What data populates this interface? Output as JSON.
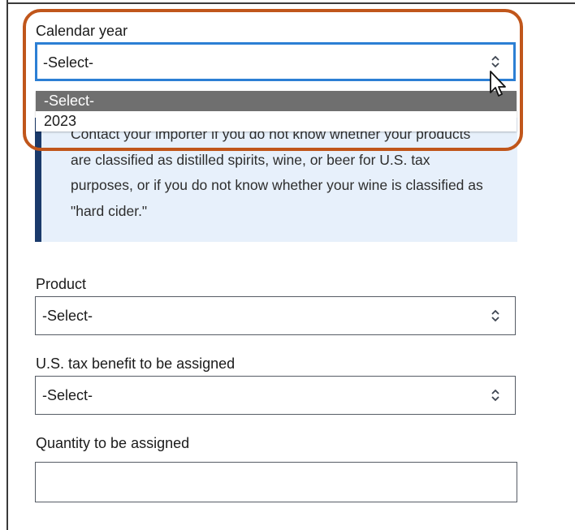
{
  "form": {
    "calendar_year": {
      "label": "Calendar year",
      "value": "-Select-",
      "options": [
        "-Select-",
        "2023"
      ]
    },
    "info_alert": {
      "text": "Contact your importer if you do not know whether your products are classified as distilled spirits, wine, or beer for U.S. tax purposes, or if you do not know whether your wine is classified as \"hard cider.\""
    },
    "product": {
      "label": "Product",
      "value": "-Select-"
    },
    "tax_benefit": {
      "label": "U.S. tax benefit to be assigned",
      "value": "-Select-"
    },
    "quantity": {
      "label": "Quantity to be assigned",
      "value": ""
    }
  },
  "colors": {
    "focus_border": "#2c7fd4",
    "highlight_outline": "#c0561b",
    "alert_background": "#e7f0fb",
    "alert_bar": "#1a3a6b",
    "selected_option": "#6f6f6f"
  }
}
